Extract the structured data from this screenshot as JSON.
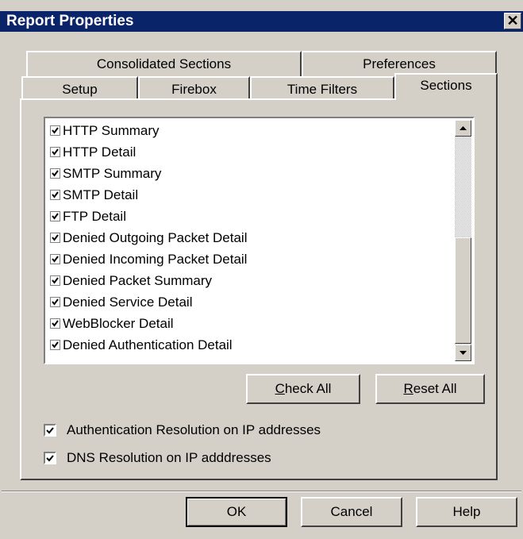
{
  "window": {
    "title": "Report Properties",
    "close_glyph": "✕"
  },
  "tabs_back": [
    {
      "label": "Consolidated Sections"
    },
    {
      "label": "Preferences"
    }
  ],
  "tabs_front": [
    {
      "label": "Setup"
    },
    {
      "label": "Firebox"
    },
    {
      "label": "Time Filters"
    },
    {
      "label": "Sections",
      "active": true
    }
  ],
  "sections_list": [
    {
      "label": "HTTP Summary",
      "checked": true
    },
    {
      "label": "HTTP Detail",
      "checked": true
    },
    {
      "label": "SMTP Summary",
      "checked": true
    },
    {
      "label": "SMTP Detail",
      "checked": true
    },
    {
      "label": "FTP Detail",
      "checked": true
    },
    {
      "label": "Denied Outgoing Packet Detail",
      "checked": true
    },
    {
      "label": "Denied Incoming Packet Detail",
      "checked": true
    },
    {
      "label": "Denied Packet Summary",
      "checked": true
    },
    {
      "label": "Denied Service Detail",
      "checked": true
    },
    {
      "label": "WebBlocker Detail",
      "checked": true
    },
    {
      "label": "Denied Authentication Detail",
      "checked": true
    }
  ],
  "list_buttons": {
    "check_all": {
      "mnemonic": "C",
      "rest": "heck All"
    },
    "reset_all": {
      "mnemonic": "R",
      "rest": "eset All"
    }
  },
  "options": [
    {
      "label": "Authentication Resolution on IP addresses",
      "checked": true
    },
    {
      "label": "DNS Resolution on IP adddresses",
      "checked": true
    }
  ],
  "dialog_buttons": {
    "ok": "OK",
    "cancel": "Cancel",
    "help": "Help"
  },
  "colors": {
    "titlebar": "#0a246a",
    "face": "#d4d0c8"
  }
}
